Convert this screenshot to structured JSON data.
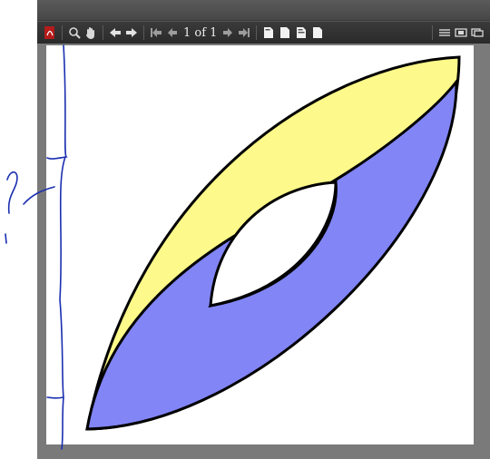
{
  "toolbar": {
    "icons": [
      "pdf-logo-icon",
      "search-icon",
      "hand-tool-icon",
      "previous-arrow-icon",
      "next-arrow-icon",
      "first-page-icon",
      "previous-page-icon",
      "next-page-icon",
      "last-page-icon",
      "single-page-icon",
      "continuous-page-icon",
      "two-page-icon",
      "two-page-continuous-icon",
      "sidebar-icon",
      "fit-width-icon",
      "fit-page-icon"
    ],
    "page_indicator": "1 of 1"
  },
  "annotation": {
    "handwritten_mark": "?",
    "ink_color": "#1a2fb0"
  },
  "figure": {
    "outer_fill": "#fdf98a",
    "inner_fill": "#8185f5",
    "hole_fill": "#ffffff",
    "stroke": "#000000"
  }
}
